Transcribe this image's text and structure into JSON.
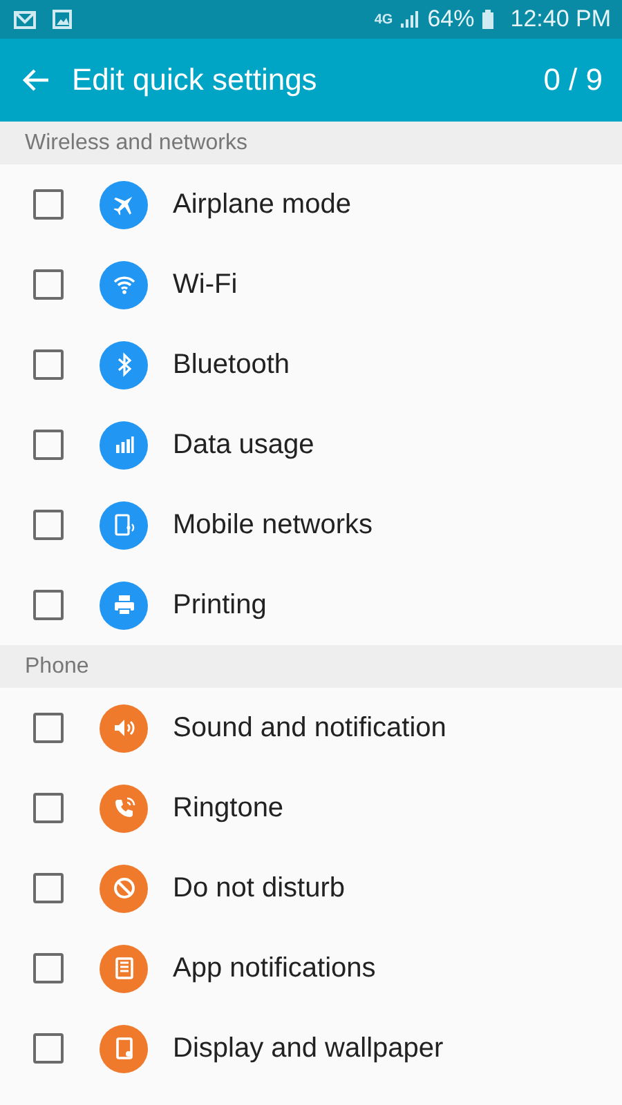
{
  "status_bar": {
    "network": "4G",
    "battery": "64%",
    "time": "12:40 PM"
  },
  "app_bar": {
    "title": "Edit quick settings",
    "counter": "0 / 9"
  },
  "sections": [
    {
      "title": "Wireless and networks",
      "color": "#2196f3",
      "items": [
        {
          "label": "Airplane mode",
          "checked": false
        },
        {
          "label": "Wi-Fi",
          "checked": false
        },
        {
          "label": "Bluetooth",
          "checked": false
        },
        {
          "label": "Data usage",
          "checked": false
        },
        {
          "label": "Mobile networks",
          "checked": false
        },
        {
          "label": "Printing",
          "checked": false
        }
      ]
    },
    {
      "title": "Phone",
      "color": "#f07a2c",
      "items": [
        {
          "label": "Sound and notification",
          "checked": false
        },
        {
          "label": "Ringtone",
          "checked": false
        },
        {
          "label": "Do not disturb",
          "checked": false
        },
        {
          "label": "App notifications",
          "checked": false
        },
        {
          "label": "Display and wallpaper",
          "checked": false
        }
      ]
    }
  ]
}
